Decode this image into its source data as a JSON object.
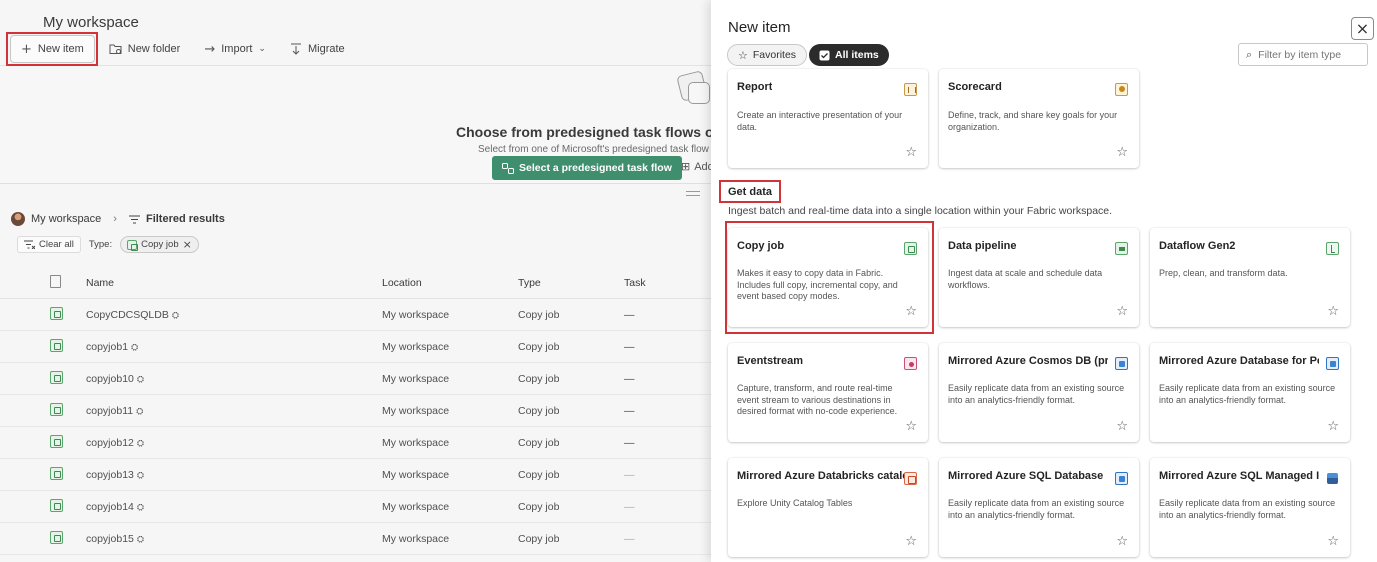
{
  "workspace": {
    "title": "My workspace",
    "toolbar": {
      "new_item": "New item",
      "new_folder": "New folder",
      "import": "Import",
      "migrate": "Migrate"
    },
    "banner": {
      "title": "Choose from predesigned task flows or",
      "subtitle": "Select from one of Microsoft's predesigned task flow",
      "button": "Select a predesigned task flow",
      "add": "Add"
    },
    "breadcrumb": {
      "workspace": "My workspace",
      "filtered": "Filtered results"
    },
    "filters": {
      "clear_all": "Clear all",
      "type_label": "Type:",
      "chip": "Copy job"
    },
    "table": {
      "headers": {
        "name": "Name",
        "location": "Location",
        "type": "Type",
        "task": "Task"
      },
      "rows": [
        {
          "name": "CopyCDCSQLDB",
          "location": "My workspace",
          "type": "Copy job",
          "task": "—"
        },
        {
          "name": "copyjob1",
          "location": "My workspace",
          "type": "Copy job",
          "task": "—"
        },
        {
          "name": "copyjob10",
          "location": "My workspace",
          "type": "Copy job",
          "task": "—"
        },
        {
          "name": "copyjob11",
          "location": "My workspace",
          "type": "Copy job",
          "task": "—"
        },
        {
          "name": "copyjob12",
          "location": "My workspace",
          "type": "Copy job",
          "task": "—"
        },
        {
          "name": "copyjob13",
          "location": "My workspace",
          "type": "Copy job",
          "task": "—"
        },
        {
          "name": "copyjob14",
          "location": "My workspace",
          "type": "Copy job",
          "task": "—"
        },
        {
          "name": "copyjob15",
          "location": "My workspace",
          "type": "Copy job",
          "task": "—"
        }
      ]
    }
  },
  "panel": {
    "title": "New item",
    "tabs": {
      "favorites": "Favorites",
      "all_items": "All items"
    },
    "filter_placeholder": "Filter by item type",
    "top_cards": [
      {
        "title": "Report",
        "desc": "Create an interactive presentation of your data."
      },
      {
        "title": "Scorecard",
        "desc": "Define, track, and share key goals for your organization."
      }
    ],
    "section": {
      "title": "Get data",
      "subtitle": "Ingest batch and real-time data into a single location within your Fabric workspace."
    },
    "cards": [
      {
        "title": "Copy job",
        "desc": "Makes it easy to copy data in Fabric. Includes full copy, incremental copy, and event based copy modes."
      },
      {
        "title": "Data pipeline",
        "desc": "Ingest data at scale and schedule data workflows."
      },
      {
        "title": "Dataflow Gen2",
        "desc": "Prep, clean, and transform data."
      },
      {
        "title": "Eventstream",
        "desc": "Capture, transform, and route real-time event stream to various destinations in desired format with no-code experience."
      },
      {
        "title": "Mirrored Azure Cosmos DB (pre...",
        "desc": "Easily replicate data from an existing source into an analytics-friendly format."
      },
      {
        "title": "Mirrored Azure Database for Po...",
        "desc": "Easily replicate data from an existing source into an analytics-friendly format."
      },
      {
        "title": "Mirrored Azure Databricks catalog",
        "desc": "Explore Unity Catalog Tables"
      },
      {
        "title": "Mirrored Azure SQL Database",
        "desc": "Easily replicate data from an existing source into an analytics-friendly format."
      },
      {
        "title": "Mirrored Azure SQL Managed In...",
        "desc": "Easily replicate data from an existing source into an analytics-friendly format."
      }
    ]
  },
  "colors": {
    "highlight": "#d13438",
    "accent_green": "#3f8f6e",
    "pill_active": "#2b2b2b"
  },
  "icons": {
    "new_item": "plus-icon",
    "new_folder": "folder-icon",
    "import": "import-arrow-icon",
    "migrate": "migrate-icon",
    "favorites": "star-icon",
    "all_items": "checkbox-icon",
    "filter": "search-icon",
    "close": "close-icon"
  }
}
